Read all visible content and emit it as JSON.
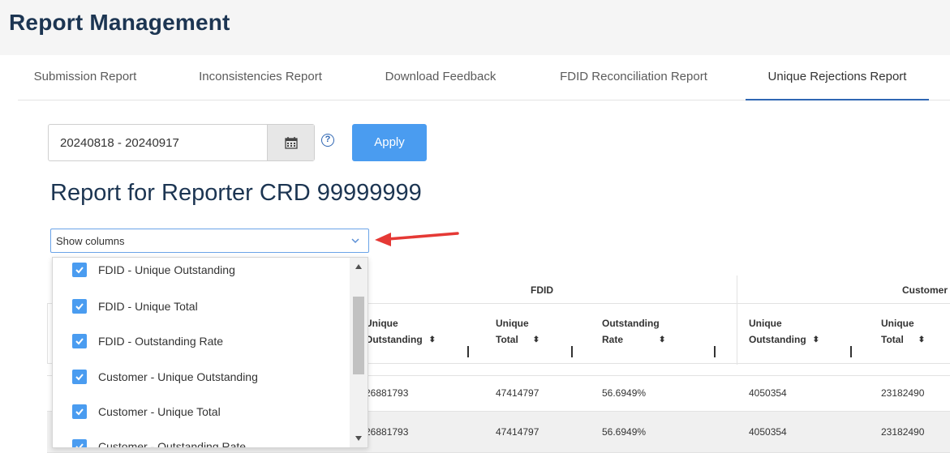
{
  "header": {
    "title": "Report Management"
  },
  "tabs": [
    {
      "label": "Submission Report"
    },
    {
      "label": "Inconsistencies Report"
    },
    {
      "label": "Download Feedback"
    },
    {
      "label": "FDID Reconciliation Report"
    },
    {
      "label": "Unique Rejections Report"
    }
  ],
  "filters": {
    "date_range": "20240818 - 20240917",
    "apply_label": "Apply"
  },
  "report": {
    "heading": "Report for Reporter CRD 99999999"
  },
  "columns_select": {
    "placeholder": "Show columns",
    "options": [
      {
        "label": "FDID - Unique Outstanding"
      },
      {
        "label": "FDID - Unique Total"
      },
      {
        "label": "FDID - Outstanding Rate"
      },
      {
        "label": "Customer - Unique Outstanding"
      },
      {
        "label": "Customer - Unique Total"
      },
      {
        "label": "Customer - Outstanding Rate"
      }
    ]
  },
  "table": {
    "groups": {
      "fdid": "FDID",
      "customer": "Customer"
    },
    "headers": {
      "fdid_outstanding": [
        "Unique",
        "Outstanding"
      ],
      "fdid_total": [
        "Unique",
        "Total"
      ],
      "fdid_rate": [
        "Outstanding",
        "Rate"
      ],
      "cust_outstanding": [
        "Unique",
        "Outstanding"
      ],
      "cust_total": [
        "Unique",
        "Total"
      ]
    },
    "rows": [
      [
        "26881793",
        "47414797",
        "56.6949%",
        "4050354",
        "23182490"
      ],
      [
        "26881793",
        "47414797",
        "56.6949%",
        "4050354",
        "23182490"
      ]
    ]
  },
  "colors": {
    "accent": "#4a9cf0",
    "title": "#1c3552",
    "arrow": "#e53935"
  }
}
